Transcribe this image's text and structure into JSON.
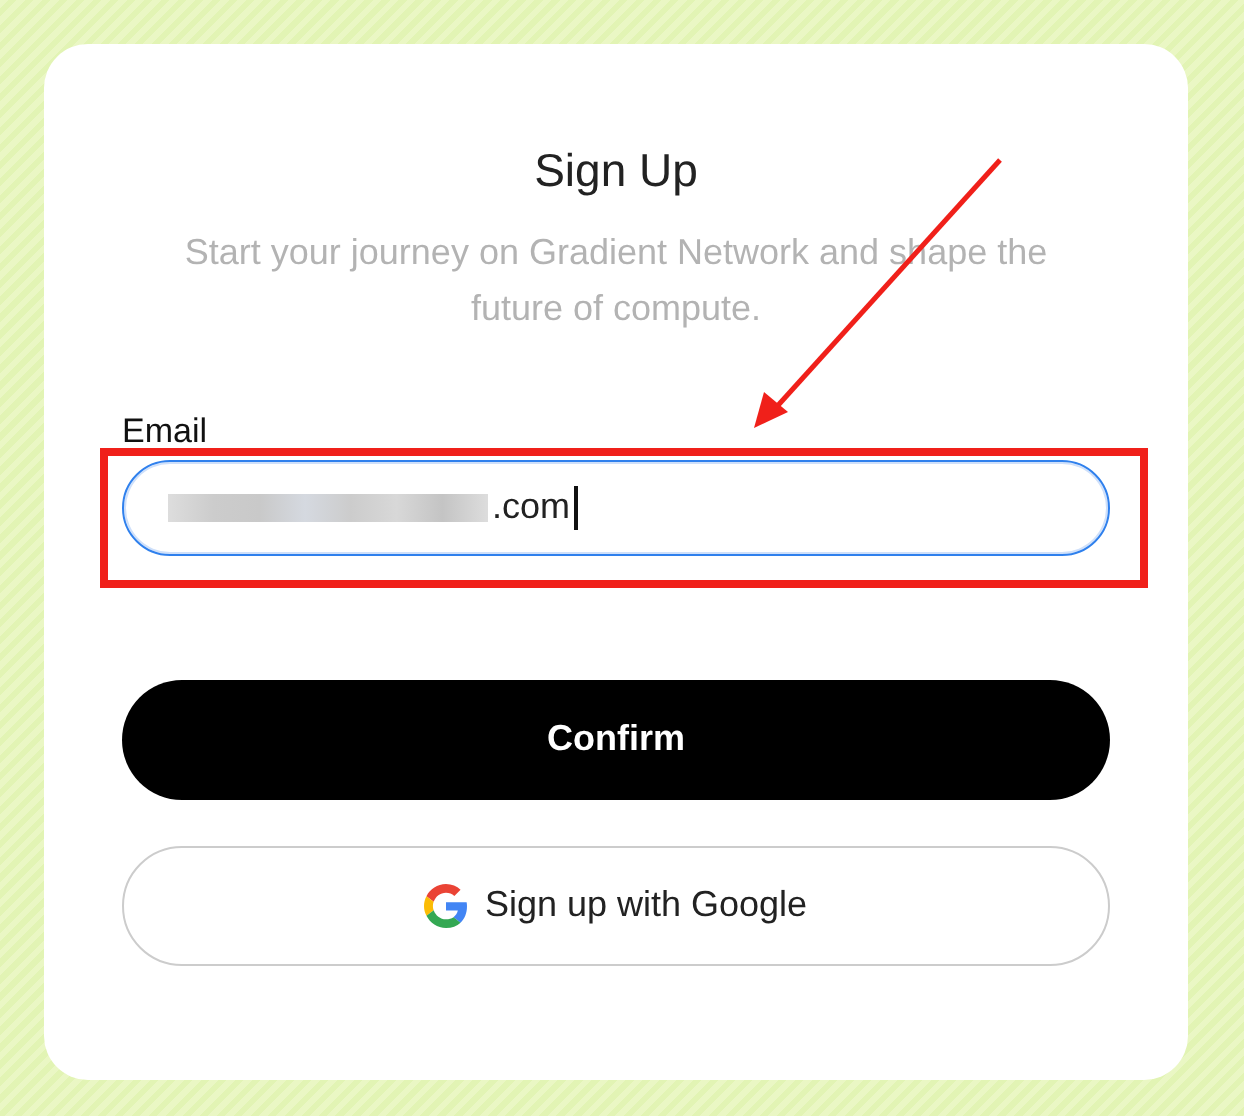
{
  "form": {
    "title": "Sign Up",
    "subtitle": "Start your journey on Gradient Network and shape the future of compute.",
    "email": {
      "label": "Email",
      "value": ".com",
      "redacted": true,
      "focused": true
    },
    "buttons": [
      {
        "kind": "primary",
        "label": "Confirm"
      },
      {
        "kind": "google",
        "label": "Sign up with Google"
      }
    ]
  },
  "annotation": {
    "kind": "box-with-arrow"
  }
}
